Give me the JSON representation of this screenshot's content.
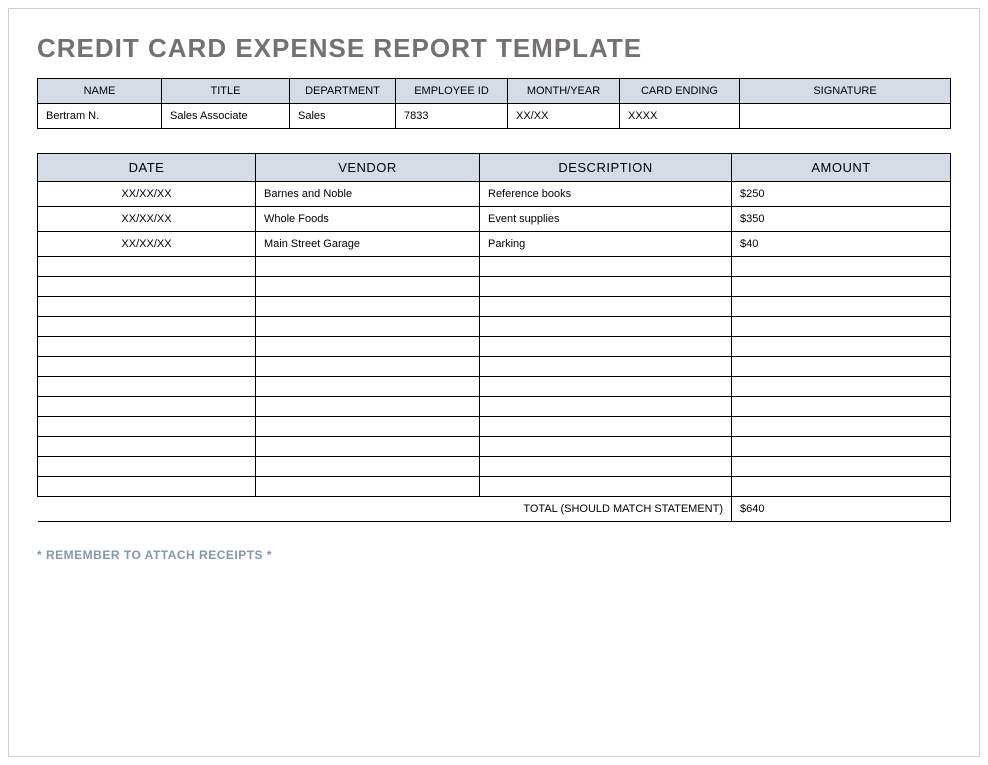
{
  "title": "CREDIT CARD EXPENSE REPORT TEMPLATE",
  "info": {
    "headers": {
      "name": "NAME",
      "title": "TITLE",
      "department": "DEPARTMENT",
      "employee_id": "EMPLOYEE ID",
      "month_year": "MONTH/YEAR",
      "card_ending": "CARD ENDING",
      "signature": "SIGNATURE"
    },
    "values": {
      "name": "Bertram N.",
      "title": "Sales Associate",
      "department": "Sales",
      "employee_id": "7833",
      "month_year": "XX/XX",
      "card_ending": "XXXX",
      "signature": ""
    }
  },
  "expenses": {
    "headers": {
      "date": "DATE",
      "vendor": "VENDOR",
      "description": "DESCRIPTION",
      "amount": "AMOUNT"
    },
    "rows": [
      {
        "date": "XX/XX/XX",
        "vendor": "Barnes and Noble",
        "description": "Reference books",
        "amount": "$250"
      },
      {
        "date": "XX/XX/XX",
        "vendor": "Whole Foods",
        "description": "Event supplies",
        "amount": "$350"
      },
      {
        "date": "XX/XX/XX",
        "vendor": "Main Street Garage",
        "description": "Parking",
        "amount": "$40"
      },
      {
        "date": "",
        "vendor": "",
        "description": "",
        "amount": ""
      },
      {
        "date": "",
        "vendor": "",
        "description": "",
        "amount": ""
      },
      {
        "date": "",
        "vendor": "",
        "description": "",
        "amount": ""
      },
      {
        "date": "",
        "vendor": "",
        "description": "",
        "amount": ""
      },
      {
        "date": "",
        "vendor": "",
        "description": "",
        "amount": ""
      },
      {
        "date": "",
        "vendor": "",
        "description": "",
        "amount": ""
      },
      {
        "date": "",
        "vendor": "",
        "description": "",
        "amount": ""
      },
      {
        "date": "",
        "vendor": "",
        "description": "",
        "amount": ""
      },
      {
        "date": "",
        "vendor": "",
        "description": "",
        "amount": ""
      },
      {
        "date": "",
        "vendor": "",
        "description": "",
        "amount": ""
      },
      {
        "date": "",
        "vendor": "",
        "description": "",
        "amount": ""
      },
      {
        "date": "",
        "vendor": "",
        "description": "",
        "amount": ""
      }
    ],
    "total_label": "TOTAL (SHOULD MATCH STATEMENT)",
    "total_value": "$640"
  },
  "reminder": "* REMEMBER TO ATTACH RECEIPTS *"
}
